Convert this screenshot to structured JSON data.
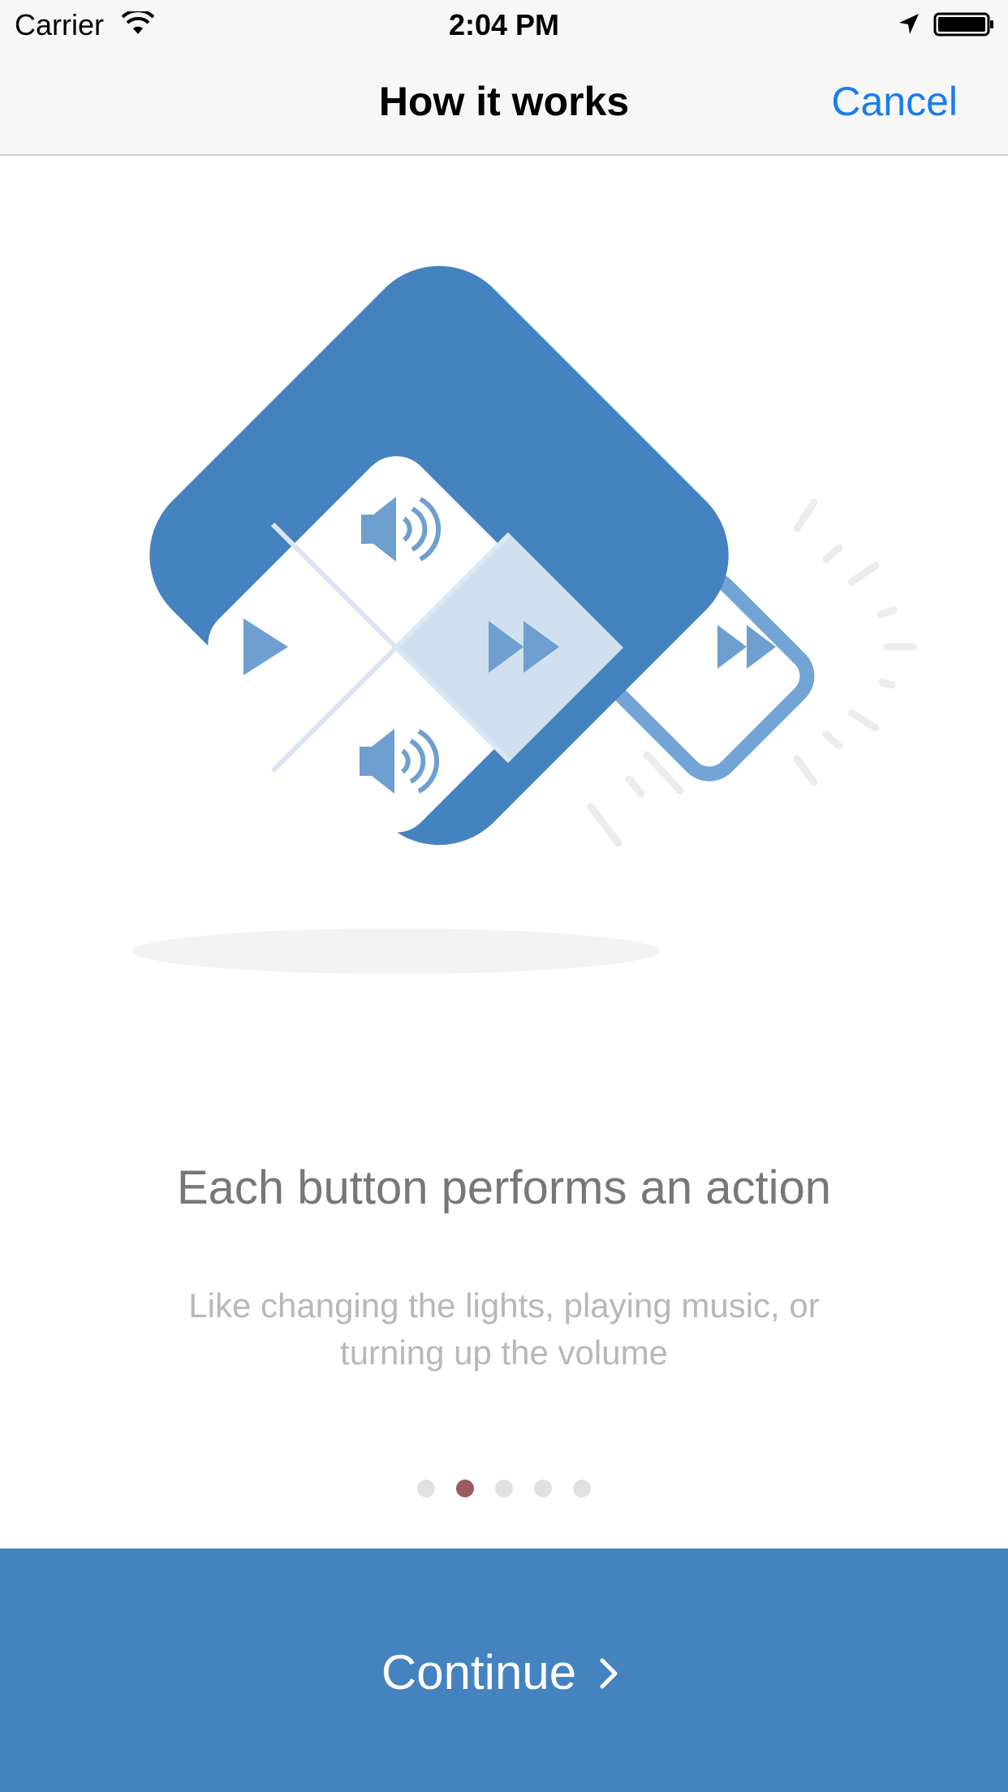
{
  "status_bar": {
    "carrier": "Carrier",
    "time": "2:04 PM",
    "icons": [
      "wifi-icon",
      "location-arrow-icon",
      "battery-icon"
    ]
  },
  "nav": {
    "title": "How it works",
    "cancel": "Cancel"
  },
  "illustration": {
    "icons": [
      "speaker-icon",
      "play-icon",
      "fast-forward-icon",
      "speaker-icon"
    ],
    "colors": {
      "frame": "#4483c0",
      "icon": "#6e9fd0",
      "highlight": "#d0e0ef",
      "small_frame": "#72a4d6"
    }
  },
  "content": {
    "headline": "Each button performs an action",
    "subtext": "Like changing the lights, playing music, or turning up the volume"
  },
  "pager": {
    "count": 5,
    "active_index": 1
  },
  "continue_button": {
    "label": "Continue",
    "icon": "chevron-right-icon",
    "color": "#4483c0"
  }
}
